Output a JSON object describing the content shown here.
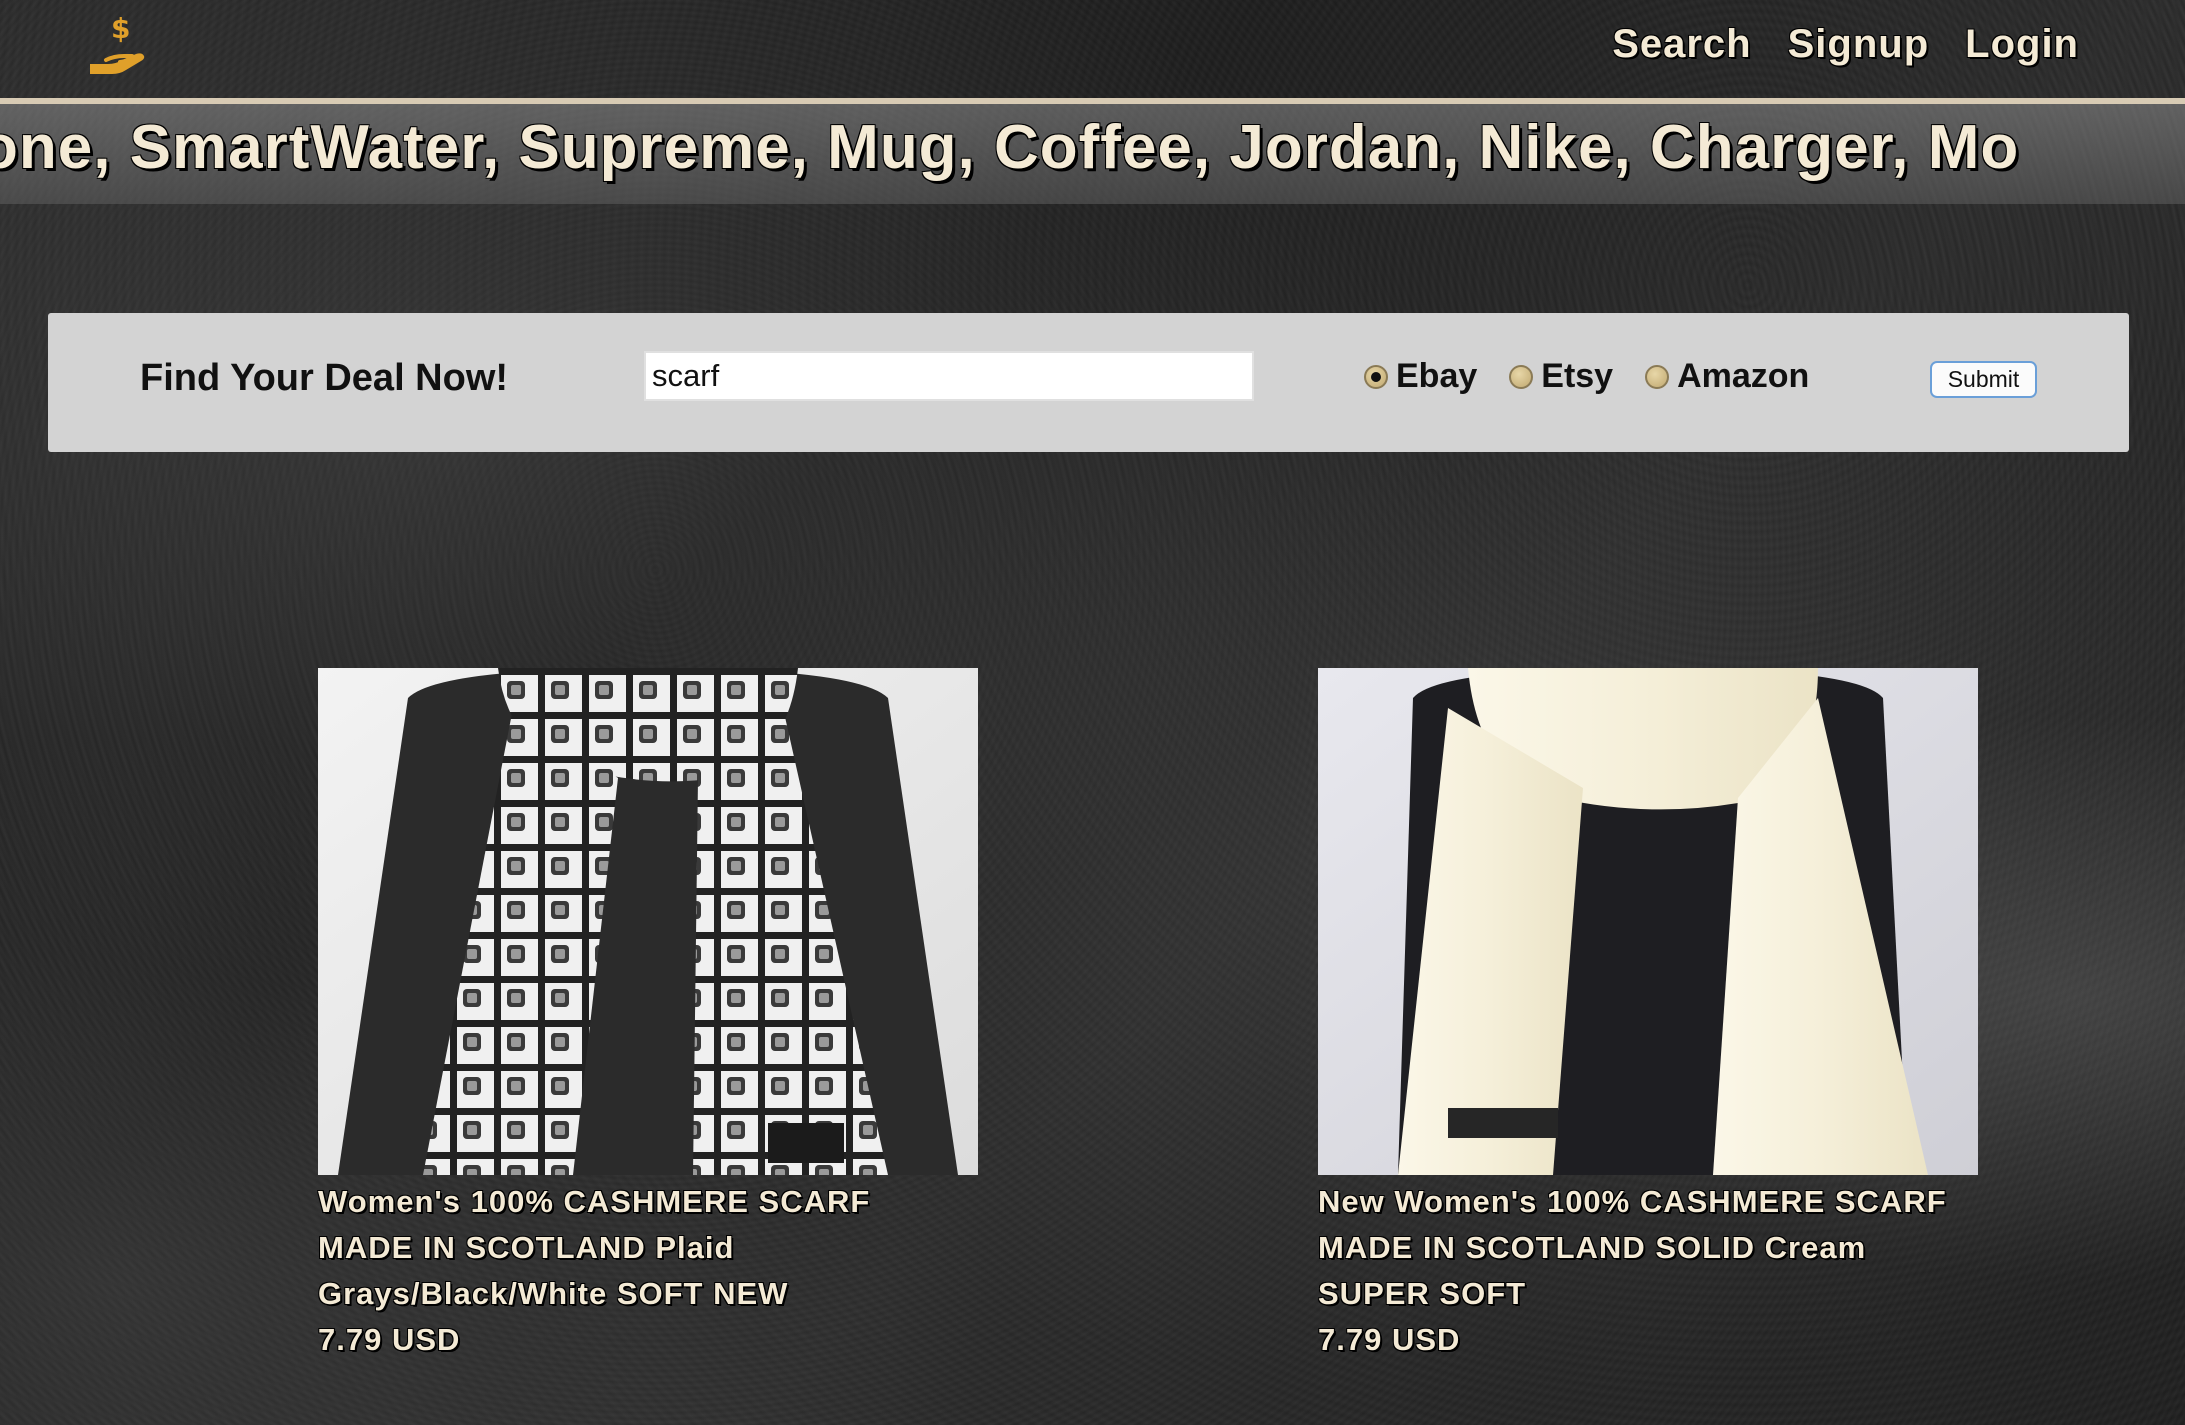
{
  "header": {
    "logo_icon": "hand-holding-dollar-icon",
    "nav": {
      "search": "Search",
      "signup": "Signup",
      "login": "Login"
    }
  },
  "marquee": {
    "text": "one, SmartWater, Supreme, Mug, Coffee, Jordan, Nike, Charger, Mo"
  },
  "search": {
    "heading": "Find Your Deal Now!",
    "query": "scarf",
    "sources": [
      {
        "label": "Ebay",
        "checked": true
      },
      {
        "label": "Etsy",
        "checked": false
      },
      {
        "label": "Amazon",
        "checked": false
      }
    ],
    "submit_label": "Submit"
  },
  "results": [
    {
      "image_icon": "black-white-plaid-scarf-photo",
      "title": "Women's 100% CASHMERE SCARF MADE IN SCOTLAND Plaid Grays/Black/White SOFT NEW",
      "price": "7.79 USD"
    },
    {
      "image_icon": "cream-solid-scarf-photo",
      "title": "New Women's 100% CASHMERE SCARF MADE IN SCOTLAND SOLID Cream SUPER SOFT",
      "price": "7.79 USD"
    }
  ],
  "colors": {
    "accent_gold": "#e0a02a",
    "text_cream": "#f4ead5",
    "panel_gray": "#d3d3d3"
  }
}
